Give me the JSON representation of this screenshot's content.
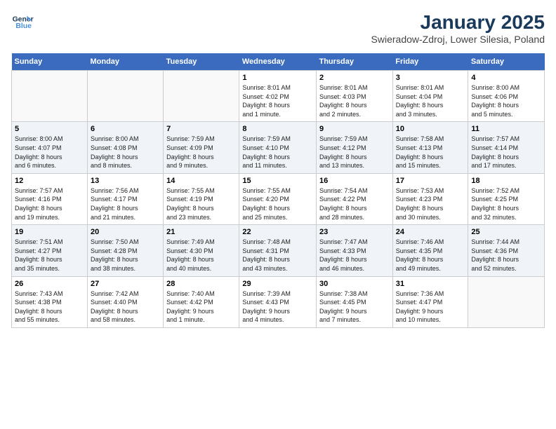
{
  "logo": {
    "line1": "General",
    "line2": "Blue"
  },
  "title": "January 2025",
  "subtitle": "Swieradow-Zdroj, Lower Silesia, Poland",
  "headers": [
    "Sunday",
    "Monday",
    "Tuesday",
    "Wednesday",
    "Thursday",
    "Friday",
    "Saturday"
  ],
  "weeks": [
    [
      {
        "day": "",
        "info": ""
      },
      {
        "day": "",
        "info": ""
      },
      {
        "day": "",
        "info": ""
      },
      {
        "day": "1",
        "info": "Sunrise: 8:01 AM\nSunset: 4:02 PM\nDaylight: 8 hours\nand 1 minute."
      },
      {
        "day": "2",
        "info": "Sunrise: 8:01 AM\nSunset: 4:03 PM\nDaylight: 8 hours\nand 2 minutes."
      },
      {
        "day": "3",
        "info": "Sunrise: 8:01 AM\nSunset: 4:04 PM\nDaylight: 8 hours\nand 3 minutes."
      },
      {
        "day": "4",
        "info": "Sunrise: 8:00 AM\nSunset: 4:06 PM\nDaylight: 8 hours\nand 5 minutes."
      }
    ],
    [
      {
        "day": "5",
        "info": "Sunrise: 8:00 AM\nSunset: 4:07 PM\nDaylight: 8 hours\nand 6 minutes."
      },
      {
        "day": "6",
        "info": "Sunrise: 8:00 AM\nSunset: 4:08 PM\nDaylight: 8 hours\nand 8 minutes."
      },
      {
        "day": "7",
        "info": "Sunrise: 7:59 AM\nSunset: 4:09 PM\nDaylight: 8 hours\nand 9 minutes."
      },
      {
        "day": "8",
        "info": "Sunrise: 7:59 AM\nSunset: 4:10 PM\nDaylight: 8 hours\nand 11 minutes."
      },
      {
        "day": "9",
        "info": "Sunrise: 7:59 AM\nSunset: 4:12 PM\nDaylight: 8 hours\nand 13 minutes."
      },
      {
        "day": "10",
        "info": "Sunrise: 7:58 AM\nSunset: 4:13 PM\nDaylight: 8 hours\nand 15 minutes."
      },
      {
        "day": "11",
        "info": "Sunrise: 7:57 AM\nSunset: 4:14 PM\nDaylight: 8 hours\nand 17 minutes."
      }
    ],
    [
      {
        "day": "12",
        "info": "Sunrise: 7:57 AM\nSunset: 4:16 PM\nDaylight: 8 hours\nand 19 minutes."
      },
      {
        "day": "13",
        "info": "Sunrise: 7:56 AM\nSunset: 4:17 PM\nDaylight: 8 hours\nand 21 minutes."
      },
      {
        "day": "14",
        "info": "Sunrise: 7:55 AM\nSunset: 4:19 PM\nDaylight: 8 hours\nand 23 minutes."
      },
      {
        "day": "15",
        "info": "Sunrise: 7:55 AM\nSunset: 4:20 PM\nDaylight: 8 hours\nand 25 minutes."
      },
      {
        "day": "16",
        "info": "Sunrise: 7:54 AM\nSunset: 4:22 PM\nDaylight: 8 hours\nand 28 minutes."
      },
      {
        "day": "17",
        "info": "Sunrise: 7:53 AM\nSunset: 4:23 PM\nDaylight: 8 hours\nand 30 minutes."
      },
      {
        "day": "18",
        "info": "Sunrise: 7:52 AM\nSunset: 4:25 PM\nDaylight: 8 hours\nand 32 minutes."
      }
    ],
    [
      {
        "day": "19",
        "info": "Sunrise: 7:51 AM\nSunset: 4:27 PM\nDaylight: 8 hours\nand 35 minutes."
      },
      {
        "day": "20",
        "info": "Sunrise: 7:50 AM\nSunset: 4:28 PM\nDaylight: 8 hours\nand 38 minutes."
      },
      {
        "day": "21",
        "info": "Sunrise: 7:49 AM\nSunset: 4:30 PM\nDaylight: 8 hours\nand 40 minutes."
      },
      {
        "day": "22",
        "info": "Sunrise: 7:48 AM\nSunset: 4:31 PM\nDaylight: 8 hours\nand 43 minutes."
      },
      {
        "day": "23",
        "info": "Sunrise: 7:47 AM\nSunset: 4:33 PM\nDaylight: 8 hours\nand 46 minutes."
      },
      {
        "day": "24",
        "info": "Sunrise: 7:46 AM\nSunset: 4:35 PM\nDaylight: 8 hours\nand 49 minutes."
      },
      {
        "day": "25",
        "info": "Sunrise: 7:44 AM\nSunset: 4:36 PM\nDaylight: 8 hours\nand 52 minutes."
      }
    ],
    [
      {
        "day": "26",
        "info": "Sunrise: 7:43 AM\nSunset: 4:38 PM\nDaylight: 8 hours\nand 55 minutes."
      },
      {
        "day": "27",
        "info": "Sunrise: 7:42 AM\nSunset: 4:40 PM\nDaylight: 8 hours\nand 58 minutes."
      },
      {
        "day": "28",
        "info": "Sunrise: 7:40 AM\nSunset: 4:42 PM\nDaylight: 9 hours\nand 1 minute."
      },
      {
        "day": "29",
        "info": "Sunrise: 7:39 AM\nSunset: 4:43 PM\nDaylight: 9 hours\nand 4 minutes."
      },
      {
        "day": "30",
        "info": "Sunrise: 7:38 AM\nSunset: 4:45 PM\nDaylight: 9 hours\nand 7 minutes."
      },
      {
        "day": "31",
        "info": "Sunrise: 7:36 AM\nSunset: 4:47 PM\nDaylight: 9 hours\nand 10 minutes."
      },
      {
        "day": "",
        "info": ""
      }
    ]
  ]
}
